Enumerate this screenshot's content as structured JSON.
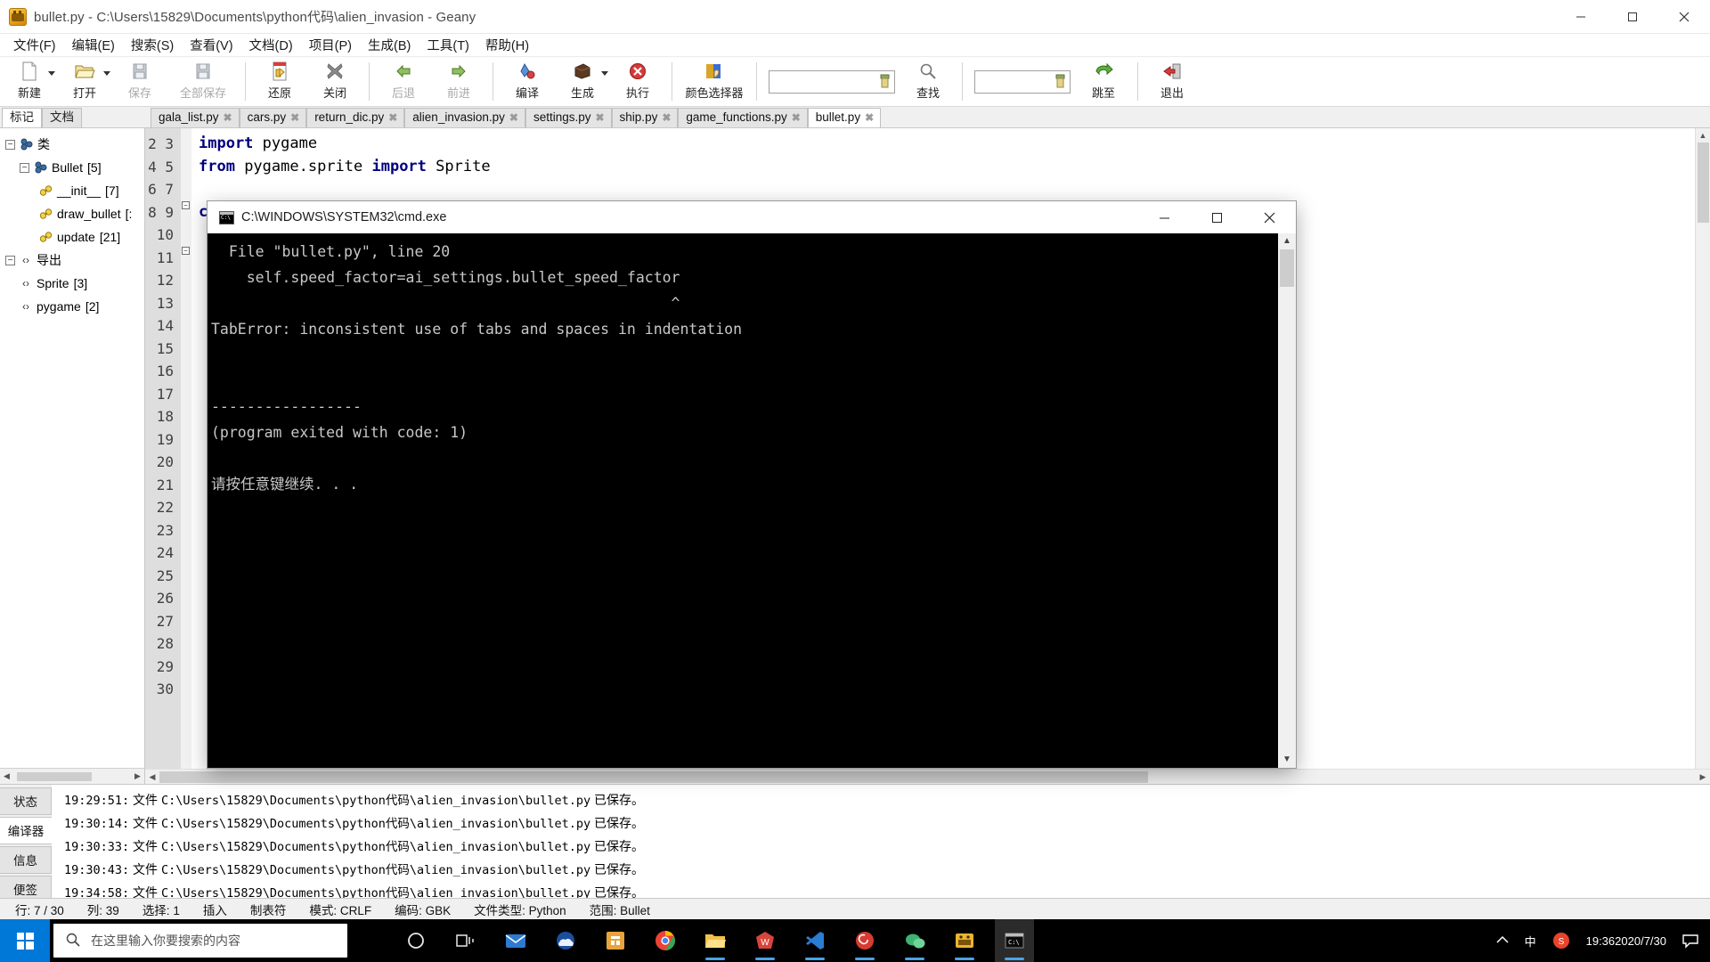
{
  "window": {
    "title": "bullet.py - C:\\Users\\15829\\Documents\\python代码\\alien_invasion - Geany",
    "minimize": "—",
    "maximize": "□",
    "close": "✕"
  },
  "menu": {
    "items": [
      {
        "label": "文件(F)"
      },
      {
        "label": "编辑(E)"
      },
      {
        "label": "搜索(S)"
      },
      {
        "label": "查看(V)"
      },
      {
        "label": "文档(D)"
      },
      {
        "label": "项目(P)"
      },
      {
        "label": "生成(B)"
      },
      {
        "label": "工具(T)"
      },
      {
        "label": "帮助(H)"
      }
    ]
  },
  "toolbar": {
    "buttons": [
      {
        "label": "新建",
        "icon": "new-file-icon",
        "dim": false,
        "dropdown": true
      },
      {
        "label": "打开",
        "icon": "open-folder-icon",
        "dim": false,
        "dropdown": true
      },
      {
        "label": "保存",
        "icon": "save-icon",
        "dim": true,
        "dropdown": false
      },
      {
        "label": "全部保存",
        "icon": "save-all-icon",
        "dim": true,
        "dropdown": false
      },
      {
        "label": "还原",
        "icon": "revert-icon",
        "dim": false,
        "dropdown": false
      },
      {
        "label": "关闭",
        "icon": "close-x-icon",
        "dim": false,
        "dropdown": false
      },
      {
        "label": "后退",
        "icon": "back-arrow-icon",
        "dim": true,
        "dropdown": false
      },
      {
        "label": "前进",
        "icon": "forward-arrow-icon",
        "dim": true,
        "dropdown": false
      },
      {
        "label": "编译",
        "icon": "compile-icon",
        "dim": false,
        "dropdown": false
      },
      {
        "label": "生成",
        "icon": "build-icon",
        "dim": false,
        "dropdown": true
      },
      {
        "label": "执行",
        "icon": "run-icon",
        "dim": false,
        "dropdown": false
      },
      {
        "label": "颜色选择器",
        "icon": "color-picker-icon",
        "dim": false,
        "dropdown": false
      }
    ],
    "search_field_value": "",
    "search_label": "查找",
    "goto_field_value": "",
    "goto_label": "跳至",
    "quit_label": "退出"
  },
  "sidebar": {
    "tabs": [
      {
        "label": "标记",
        "active": true
      },
      {
        "label": "文档",
        "active": false
      }
    ],
    "tree": [
      {
        "indent": 0,
        "toggle": "−",
        "icon": "class-group-icon",
        "label": "类",
        "count": ""
      },
      {
        "indent": 1,
        "toggle": "−",
        "icon": "class-icon",
        "label": "Bullet",
        "count": "[5]"
      },
      {
        "indent": 2,
        "toggle": "",
        "icon": "method-icon",
        "label": "__init__",
        "count": "[7]"
      },
      {
        "indent": 2,
        "toggle": "",
        "icon": "method-icon",
        "label": "draw_bullet",
        "count": "[:"
      },
      {
        "indent": 2,
        "toggle": "",
        "icon": "method-icon",
        "label": "update",
        "count": "[21]"
      },
      {
        "indent": 0,
        "toggle": "−",
        "icon": "namespace-icon",
        "label": "导出",
        "count": ""
      },
      {
        "indent": 1,
        "toggle": "",
        "icon": "namespace-icon",
        "label": "Sprite",
        "count": "[3]"
      },
      {
        "indent": 1,
        "toggle": "",
        "icon": "namespace-icon",
        "label": "pygame",
        "count": "[2]"
      }
    ]
  },
  "filetabs": [
    {
      "label": "gala_list.py",
      "active": false
    },
    {
      "label": "cars.py",
      "active": false
    },
    {
      "label": "return_dic.py",
      "active": false
    },
    {
      "label": "alien_invasion.py",
      "active": false
    },
    {
      "label": "settings.py",
      "active": false
    },
    {
      "label": "ship.py",
      "active": false
    },
    {
      "label": "game_functions.py",
      "active": false
    },
    {
      "label": "bullet.py",
      "active": true
    }
  ],
  "editor": {
    "first_line": 2,
    "line_numbers": [
      2,
      3,
      4,
      5,
      6,
      7,
      8,
      9,
      10,
      11,
      12,
      13,
      14,
      15,
      16,
      17,
      18,
      19,
      20,
      21,
      22,
      23,
      24,
      25,
      26,
      27,
      28,
      29,
      30
    ],
    "lines": [
      {
        "n": 2,
        "text": "import pygame",
        "kw": "import"
      },
      {
        "n": 3,
        "text": "from pygame.sprite import Sprite",
        "kw": "from"
      },
      {
        "n": 4,
        "text": "",
        "kw": ""
      },
      {
        "n": 5,
        "text": "class Bullet(Sprite):",
        "kw": "class"
      }
    ]
  },
  "cmd": {
    "title": "C:\\WINDOWS\\SYSTEM32\\cmd.exe",
    "minimize": "—",
    "maximize": "□",
    "close": "✕",
    "output": "  File \"bullet.py\", line 20\n    self.speed_factor=ai_settings.bullet_speed_factor\n                                                    ^\nTabError: inconsistent use of tabs and spaces in indentation\n\n\n-----------------\n(program exited with code: 1)\n\n请按任意键继续. . ."
  },
  "messages": {
    "tabs": [
      {
        "label": "状态",
        "active": false
      },
      {
        "label": "编译器",
        "active": true
      },
      {
        "label": "信息",
        "active": false
      },
      {
        "label": "便签",
        "active": false
      }
    ],
    "rows": [
      {
        "time": "19:29:51:",
        "prefix": "文件",
        "path": "C:\\Users\\15829\\Documents\\python代码\\alien_invasion\\bullet.py",
        "suffix": "已保存。"
      },
      {
        "time": "19:30:14:",
        "prefix": "文件",
        "path": "C:\\Users\\15829\\Documents\\python代码\\alien_invasion\\bullet.py",
        "suffix": "已保存。"
      },
      {
        "time": "19:30:33:",
        "prefix": "文件",
        "path": "C:\\Users\\15829\\Documents\\python代码\\alien_invasion\\bullet.py",
        "suffix": "已保存。"
      },
      {
        "time": "19:30:43:",
        "prefix": "文件",
        "path": "C:\\Users\\15829\\Documents\\python代码\\alien_invasion\\bullet.py",
        "suffix": "已保存。"
      },
      {
        "time": "19:34:58:",
        "prefix": "文件",
        "path": "C:\\Users\\15829\\Documents\\python代码\\alien_invasion\\bullet.py",
        "suffix": "已保存。"
      }
    ]
  },
  "statusbar": {
    "cells": [
      "行: 7 / 30",
      "列: 39",
      "选择: 1",
      "插入",
      "制表符",
      "模式: CRLF",
      "编码: GBK",
      "文件类型: Python",
      "范围: Bullet"
    ]
  },
  "taskbar": {
    "search_placeholder": "在这里输入你要搜索的内容",
    "clock_time": "19:36",
    "clock_date": "2020/7/30",
    "ime_indicator": "中",
    "icons": [
      {
        "name": "cortana-icon"
      },
      {
        "name": "task-view-icon"
      },
      {
        "name": "mail-icon"
      },
      {
        "name": "weather-icon"
      },
      {
        "name": "microsoft-store-icon"
      },
      {
        "name": "chrome-icon"
      },
      {
        "name": "file-explorer-icon"
      },
      {
        "name": "wps-icon"
      },
      {
        "name": "vscode-icon"
      },
      {
        "name": "netease-music-icon"
      },
      {
        "name": "wechat-icon"
      },
      {
        "name": "geany-icon"
      },
      {
        "name": "cmd-icon"
      }
    ]
  }
}
